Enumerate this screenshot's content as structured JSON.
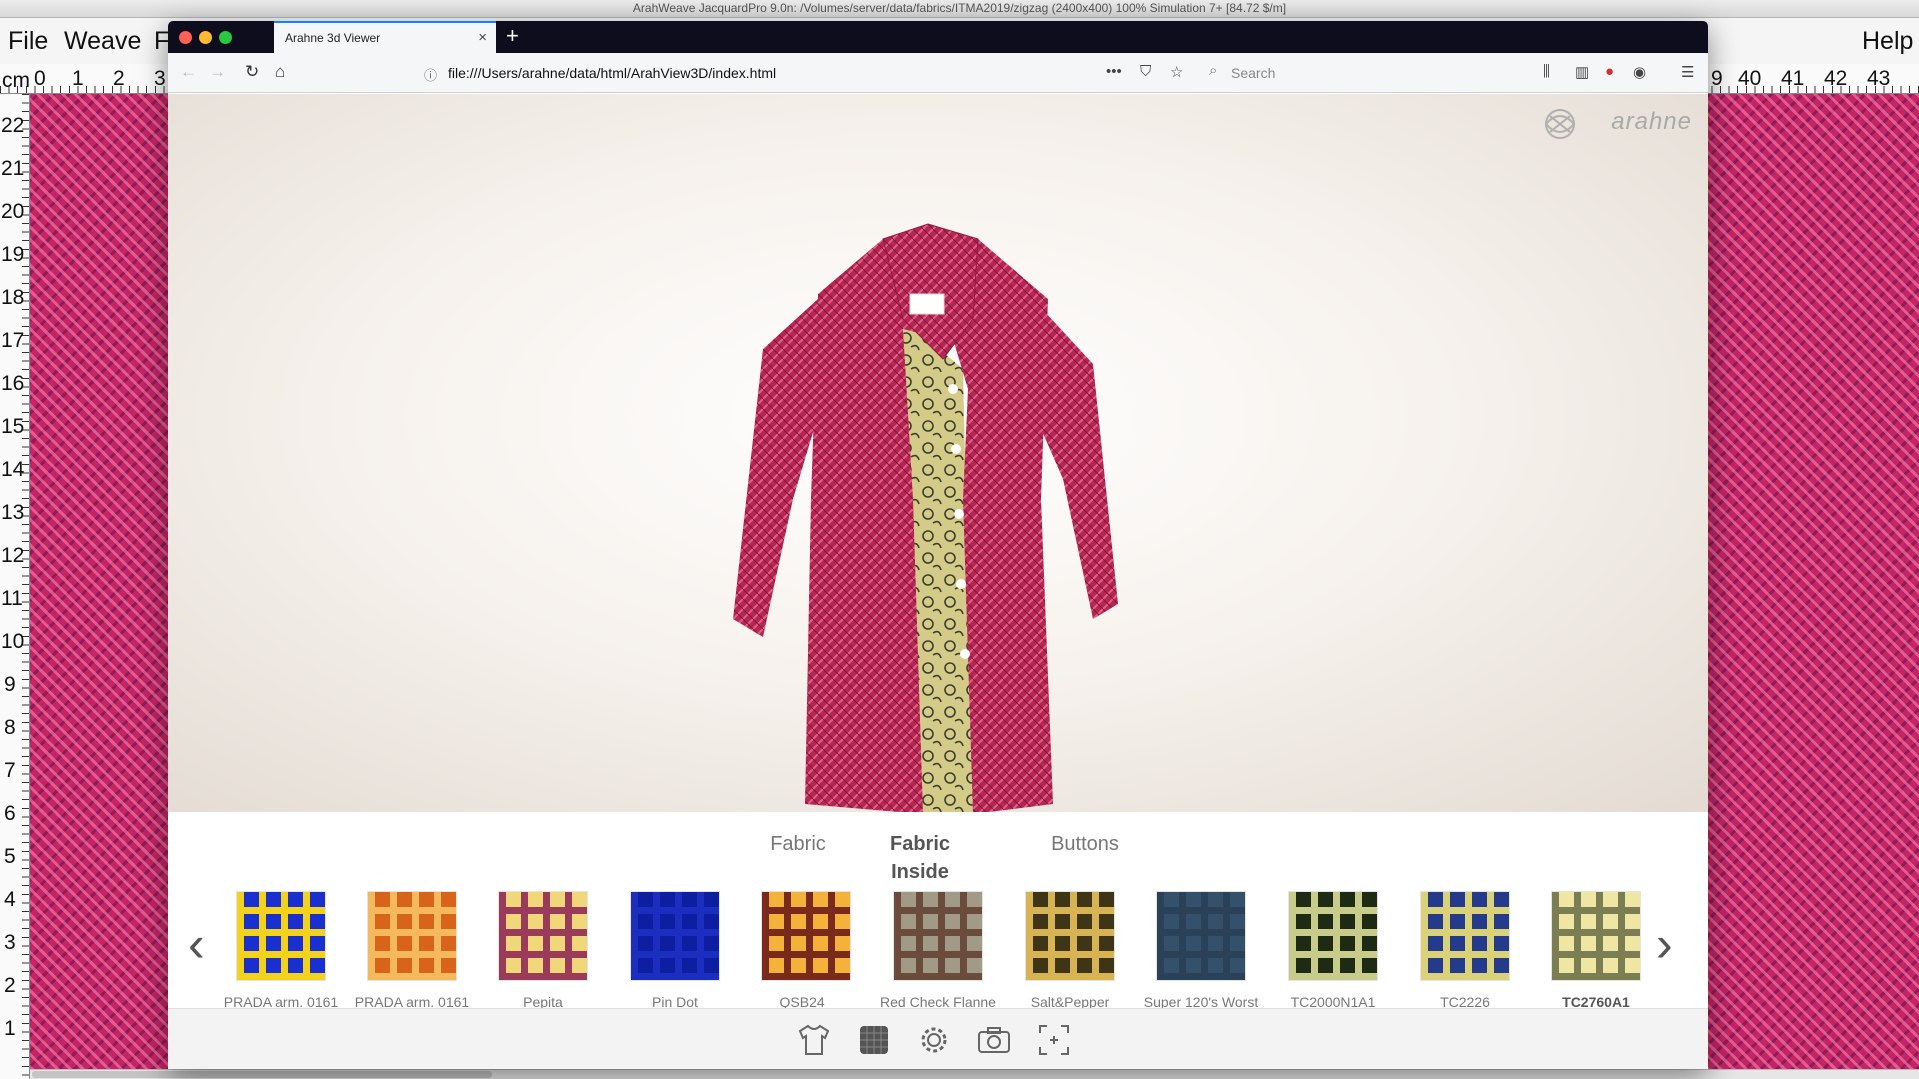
{
  "host_app": {
    "title": "ArahWeave JacquardPro 9.0n: /Volumes/server/data/fabrics/ITMA2019/zigzag (2400x400) 100% Simulation 7+ [84.72 $/m]",
    "menus": [
      "File",
      "Weave",
      "F",
      "Help"
    ],
    "ruler_unit": "cm",
    "ruler_top_left": [
      "0",
      "1",
      "2",
      "3"
    ],
    "ruler_top_right": [
      "9",
      "40",
      "41",
      "42",
      "43"
    ],
    "ruler_left": [
      "22",
      "21",
      "20",
      "19",
      "18",
      "17",
      "16",
      "15",
      "14",
      "13",
      "12",
      "11",
      "10",
      "9",
      "8",
      "7",
      "6",
      "5",
      "4",
      "3",
      "2",
      "1"
    ]
  },
  "browser": {
    "tab_title": "Arahne 3d Viewer",
    "tab_close": "×",
    "new_tab": "+",
    "url": "file:///Users/arahne/data/html/ArahView3D/index.html",
    "search_placeholder": "Search",
    "more": "•••"
  },
  "viewer": {
    "brand": "arahne",
    "garment_icon": "coat-3d-model",
    "categories": [
      {
        "label": "Fabric",
        "active": false
      },
      {
        "label": "Fabric Inside",
        "active": true
      },
      {
        "label": "Buttons",
        "active": false
      }
    ],
    "prev_arrow": "‹",
    "next_arrow": "›",
    "swatches": [
      {
        "label": "PRADA arm. 0161",
        "c1": "#1a2fd0",
        "c2": "#f2d21d"
      },
      {
        "label": "PRADA arm. 0161",
        "c1": "#d8641a",
        "c2": "#f4b95c"
      },
      {
        "label": "Pepita",
        "c1": "#f0d77a",
        "c2": "#9b3b5a"
      },
      {
        "label": "Pin Dot",
        "c1": "#0d1fa0",
        "c2": "#1b2ec0"
      },
      {
        "label": "QSB24_",
        "c1": "#f4b23a",
        "c2": "#7a2a1a"
      },
      {
        "label": "Red Check Flanne",
        "c1": "#a19a86",
        "c2": "#6b4b3b"
      },
      {
        "label": "Salt&Pepper",
        "c1": "#3d3515",
        "c2": "#d7b354"
      },
      {
        "label": "Super 120's Worst",
        "c1": "#35506b",
        "c2": "#2b4158"
      },
      {
        "label": "TC2000N1A1",
        "c1": "#1e2a14",
        "c2": "#c7cc8a"
      },
      {
        "label": "TC2226",
        "c1": "#243b8c",
        "c2": "#d9d27a"
      },
      {
        "label": "TC2760A1",
        "c1": "#efe6a4",
        "c2": "#7b7d52",
        "selected": true
      }
    ],
    "toolbar_icons": [
      "shirt-icon",
      "fabric-icon",
      "gear-icon",
      "camera-icon",
      "fullscreen-icon"
    ]
  },
  "colors": {
    "coat": "#b52752",
    "lining": "#cdc383",
    "accent": "#0a84ff"
  }
}
